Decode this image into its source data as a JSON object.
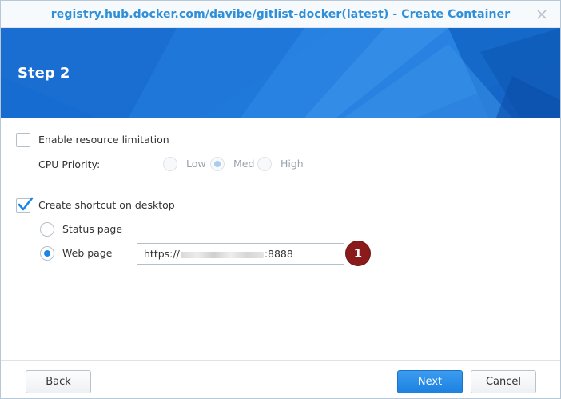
{
  "window": {
    "title": "registry.hub.docker.com/davibe/gitlist-docker(latest) - Create Container"
  },
  "banner": {
    "step_title": "Step 2"
  },
  "resource_limit": {
    "label": "Enable resource limitation",
    "checked": false
  },
  "cpu_priority": {
    "label": "CPU Priority:",
    "options": [
      "Low",
      "Med",
      "High"
    ],
    "selected": "Med",
    "enabled": false
  },
  "shortcut": {
    "label": "Create shortcut on desktop",
    "checked": true,
    "options": {
      "status_page": "Status page",
      "web_page": "Web page"
    },
    "selected": "Web page"
  },
  "web_page_url": {
    "prefix": "https://",
    "suffix": ":8888"
  },
  "annotation": {
    "number": "1",
    "color": "#8b1a1a"
  },
  "footer": {
    "back_label": "Back",
    "next_label": "Next",
    "cancel_label": "Cancel"
  },
  "colors": {
    "accent": "#1a86e8",
    "title_text": "#2f8fd8",
    "banner": "#1a6fd4"
  }
}
